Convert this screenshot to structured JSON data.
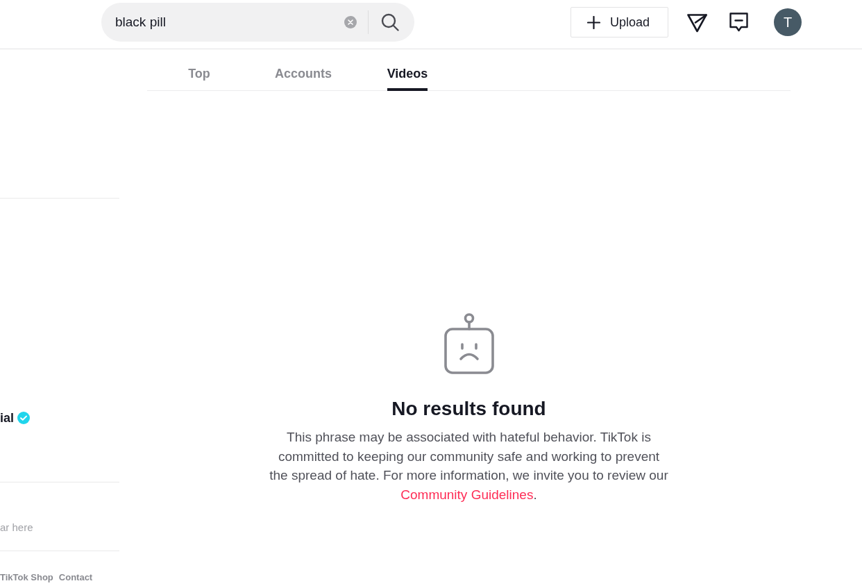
{
  "header": {
    "search": {
      "value": "black pill"
    },
    "upload_button": {
      "label": "Upload"
    },
    "avatar": {
      "initial": "T"
    }
  },
  "sidebar": {
    "account": {
      "name": "ial",
      "verified": true
    },
    "following_hint": "ar here",
    "footer_links": [
      "TikTok Shop",
      "Contact"
    ]
  },
  "tabs": [
    {
      "label": "Top",
      "selected": false
    },
    {
      "label": "Accounts",
      "selected": false
    },
    {
      "label": "Videos",
      "selected": true
    }
  ],
  "empty_state": {
    "title": "No results found",
    "message": "This phrase may be associated with hateful behavior. TikTok is committed to keeping our community safe and working to prevent the spread of hate. For more information, we invite you to review our",
    "link": "Community Guidelines",
    "message_end": "."
  }
}
